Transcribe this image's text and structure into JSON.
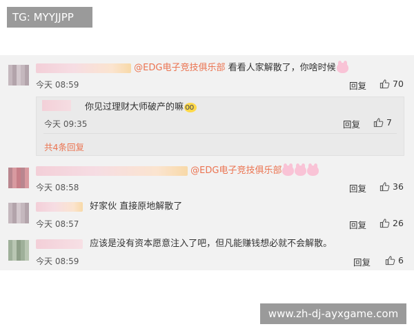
{
  "watermark_top": "TG: MYYJJPP",
  "watermark_bottom": "www.zh-dj-ayxgame.com",
  "colors": {
    "mention": "#eb7350",
    "feed_bg": "#f2f2f2",
    "badge_bg": "#9a9a9a"
  },
  "reply_label": "回复",
  "comments": [
    {
      "mention": "@EDG电子竞技俱乐部",
      "text": " 看看人家解散了，你啥时候",
      "time": "今天 08:59",
      "likes": "70"
    },
    {
      "mention": "@EDG电子竞技俱乐部",
      "text": "",
      "time": "今天 08:58",
      "likes": "36"
    },
    {
      "text": "好家伙 直接原地解散了",
      "time": "今天 08:57",
      "likes": "26"
    },
    {
      "text": "应该是没有资本愿意注入了吧，但凡能赚钱想必就不会解散。",
      "time": "今天 08:59",
      "likes": "6"
    }
  ],
  "sub_reply": {
    "text": "你见过理财大师破产的嘛",
    "time": "今天 09:35",
    "likes": "7"
  },
  "more_replies": "共4条回复"
}
